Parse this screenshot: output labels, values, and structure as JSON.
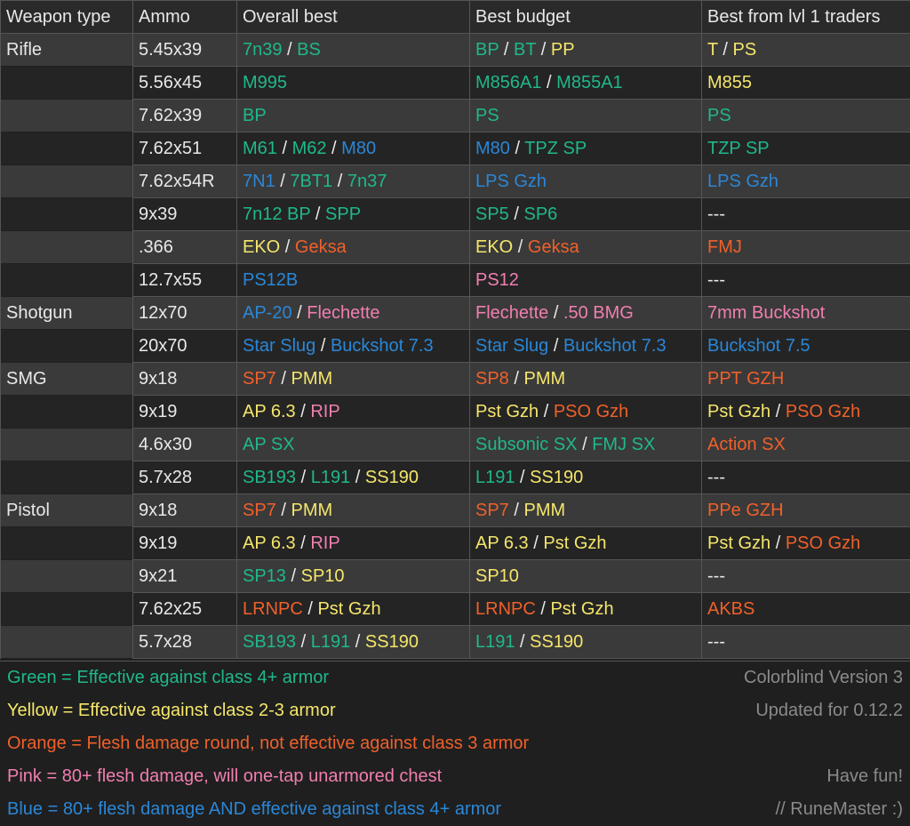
{
  "colors": {
    "green": "#1fb88b",
    "yellow": "#f5e66b",
    "orange": "#f0602a",
    "pink": "#f07fb0",
    "blue": "#2a87d8",
    "white": "#e8e8e8",
    "gray": "#8a8a8a"
  },
  "headers": [
    "Weapon type",
    "Ammo",
    "Overall best",
    "Best budget",
    "Best from lvl 1 traders"
  ],
  "groups": [
    {
      "weapon": "Rifle",
      "rows": [
        {
          "ammo": "5.45x39",
          "overall": [
            {
              "t": "7n39",
              "c": "green"
            },
            {
              "t": "BS",
              "c": "green"
            }
          ],
          "budget": [
            {
              "t": "BP",
              "c": "green"
            },
            {
              "t": "BT",
              "c": "green"
            },
            {
              "t": "PP",
              "c": "yellow"
            }
          ],
          "traders": [
            {
              "t": "T",
              "c": "yellow"
            },
            {
              "t": "PS",
              "c": "yellow"
            }
          ]
        },
        {
          "ammo": "5.56x45",
          "overall": [
            {
              "t": "M995",
              "c": "green"
            }
          ],
          "budget": [
            {
              "t": "M856A1",
              "c": "green"
            },
            {
              "t": "M855A1",
              "c": "green"
            }
          ],
          "traders": [
            {
              "t": "M855",
              "c": "yellow"
            }
          ]
        },
        {
          "ammo": "7.62x39",
          "overall": [
            {
              "t": "BP",
              "c": "green"
            }
          ],
          "budget": [
            {
              "t": "PS",
              "c": "green"
            }
          ],
          "traders": [
            {
              "t": "PS",
              "c": "green"
            }
          ]
        },
        {
          "ammo": "7.62x51",
          "overall": [
            {
              "t": "M61",
              "c": "green"
            },
            {
              "t": "M62",
              "c": "green"
            },
            {
              "t": "M80",
              "c": "blue"
            }
          ],
          "budget": [
            {
              "t": "M80",
              "c": "blue"
            },
            {
              "t": "TPZ SP",
              "c": "green"
            }
          ],
          "traders": [
            {
              "t": "TZP SP",
              "c": "green"
            }
          ]
        },
        {
          "ammo": "7.62x54R",
          "overall": [
            {
              "t": "7N1",
              "c": "blue"
            },
            {
              "t": "7BT1",
              "c": "green"
            },
            {
              "t": "7n37",
              "c": "green"
            }
          ],
          "budget": [
            {
              "t": "LPS Gzh",
              "c": "blue"
            }
          ],
          "traders": [
            {
              "t": "LPS Gzh",
              "c": "blue"
            }
          ]
        },
        {
          "ammo": "9x39",
          "overall": [
            {
              "t": "7n12 BP",
              "c": "green"
            },
            {
              "t": "SPP",
              "c": "green"
            }
          ],
          "budget": [
            {
              "t": "SP5",
              "c": "green"
            },
            {
              "t": "SP6",
              "c": "green"
            }
          ],
          "traders": [
            {
              "t": "---",
              "c": "white"
            }
          ]
        },
        {
          "ammo": ".366",
          "overall": [
            {
              "t": "EKO",
              "c": "yellow"
            },
            {
              "t": "Geksa",
              "c": "orange"
            }
          ],
          "budget": [
            {
              "t": "EKO",
              "c": "yellow"
            },
            {
              "t": "Geksa",
              "c": "orange"
            }
          ],
          "traders": [
            {
              "t": "FMJ",
              "c": "orange"
            }
          ]
        },
        {
          "ammo": "12.7x55",
          "overall": [
            {
              "t": "PS12B",
              "c": "blue"
            }
          ],
          "budget": [
            {
              "t": "PS12",
              "c": "pink"
            }
          ],
          "traders": [
            {
              "t": "---",
              "c": "white"
            }
          ]
        }
      ]
    },
    {
      "weapon": "Shotgun",
      "rows": [
        {
          "ammo": "12x70",
          "overall": [
            {
              "t": "AP-20",
              "c": "blue"
            },
            {
              "t": "Flechette",
              "c": "pink"
            }
          ],
          "budget": [
            {
              "t": "Flechette",
              "c": "pink"
            },
            {
              "t": ".50 BMG",
              "c": "pink"
            }
          ],
          "traders": [
            {
              "t": "7mm Buckshot",
              "c": "pink"
            }
          ]
        },
        {
          "ammo": "20x70",
          "overall": [
            {
              "t": "Star Slug",
              "c": "blue"
            },
            {
              "t": "Buckshot 7.3",
              "c": "blue"
            }
          ],
          "budget": [
            {
              "t": "Star Slug",
              "c": "blue"
            },
            {
              "t": "Buckshot 7.3",
              "c": "blue"
            }
          ],
          "traders": [
            {
              "t": "Buckshot 7.5",
              "c": "blue"
            }
          ]
        }
      ]
    },
    {
      "weapon": "SMG",
      "rows": [
        {
          "ammo": "9x18",
          "overall": [
            {
              "t": "SP7",
              "c": "orange"
            },
            {
              "t": "PMM",
              "c": "yellow"
            }
          ],
          "budget": [
            {
              "t": "SP8",
              "c": "orange"
            },
            {
              "t": "PMM",
              "c": "yellow"
            }
          ],
          "traders": [
            {
              "t": "PPT GZH",
              "c": "orange"
            }
          ]
        },
        {
          "ammo": "9x19",
          "overall": [
            {
              "t": "AP 6.3",
              "c": "yellow"
            },
            {
              "t": "RIP",
              "c": "pink"
            }
          ],
          "budget": [
            {
              "t": "Pst Gzh",
              "c": "yellow"
            },
            {
              "t": "PSO Gzh",
              "c": "orange"
            }
          ],
          "traders": [
            {
              "t": "Pst Gzh",
              "c": "yellow"
            },
            {
              "t": "PSO Gzh",
              "c": "orange"
            }
          ]
        },
        {
          "ammo": "4.6x30",
          "overall": [
            {
              "t": "AP SX",
              "c": "green"
            }
          ],
          "budget": [
            {
              "t": "Subsonic SX",
              "c": "green"
            },
            {
              "t": "FMJ SX",
              "c": "green"
            }
          ],
          "traders": [
            {
              "t": "Action SX",
              "c": "orange"
            }
          ]
        },
        {
          "ammo": "5.7x28",
          "overall": [
            {
              "t": "SB193",
              "c": "green"
            },
            {
              "t": "L191",
              "c": "green"
            },
            {
              "t": "SS190",
              "c": "yellow"
            }
          ],
          "budget": [
            {
              "t": "L191",
              "c": "green"
            },
            {
              "t": "SS190",
              "c": "yellow"
            }
          ],
          "traders": [
            {
              "t": "---",
              "c": "white"
            }
          ]
        }
      ]
    },
    {
      "weapon": "Pistol",
      "rows": [
        {
          "ammo": "9x18",
          "overall": [
            {
              "t": "SP7",
              "c": "orange"
            },
            {
              "t": "PMM",
              "c": "yellow"
            }
          ],
          "budget": [
            {
              "t": "SP7",
              "c": "orange"
            },
            {
              "t": "PMM",
              "c": "yellow"
            }
          ],
          "traders": [
            {
              "t": "PPe GZH",
              "c": "orange"
            }
          ]
        },
        {
          "ammo": "9x19",
          "overall": [
            {
              "t": "AP 6.3",
              "c": "yellow"
            },
            {
              "t": "RIP",
              "c": "pink"
            }
          ],
          "budget": [
            {
              "t": "AP 6.3",
              "c": "yellow"
            },
            {
              "t": "Pst Gzh",
              "c": "yellow"
            }
          ],
          "traders": [
            {
              "t": "Pst Gzh",
              "c": "yellow"
            },
            {
              "t": "PSO Gzh",
              "c": "orange"
            }
          ]
        },
        {
          "ammo": "9x21",
          "overall": [
            {
              "t": "SP13",
              "c": "green"
            },
            {
              "t": "SP10",
              "c": "yellow"
            }
          ],
          "budget": [
            {
              "t": "SP10",
              "c": "yellow"
            }
          ],
          "traders": [
            {
              "t": "---",
              "c": "white"
            }
          ]
        },
        {
          "ammo": "7.62x25",
          "overall": [
            {
              "t": "LRNPC",
              "c": "orange"
            },
            {
              "t": "Pst Gzh",
              "c": "yellow"
            }
          ],
          "budget": [
            {
              "t": "LRNPC",
              "c": "orange"
            },
            {
              "t": "Pst Gzh",
              "c": "yellow"
            }
          ],
          "traders": [
            {
              "t": "AKBS",
              "c": "orange"
            }
          ]
        },
        {
          "ammo": "5.7x28",
          "overall": [
            {
              "t": "SB193",
              "c": "green"
            },
            {
              "t": "L191",
              "c": "green"
            },
            {
              "t": "SS190",
              "c": "yellow"
            }
          ],
          "budget": [
            {
              "t": "L191",
              "c": "green"
            },
            {
              "t": "SS190",
              "c": "yellow"
            }
          ],
          "traders": [
            {
              "t": "---",
              "c": "white"
            }
          ]
        }
      ]
    }
  ],
  "legend": [
    {
      "text": "Green = Effective against class 4+ armor",
      "c": "green",
      "note": "Colorblind Version 3"
    },
    {
      "text": "Yellow = Effective against class 2-3 armor",
      "c": "yellow",
      "note": "Updated for 0.12.2"
    },
    {
      "text": "Orange = Flesh damage round, not effective against class 3 armor",
      "c": "orange",
      "note": ""
    },
    {
      "text": "Pink = 80+ flesh damage, will one-tap unarmored chest",
      "c": "pink",
      "note": "Have fun!"
    },
    {
      "text": "Blue = 80+ flesh damage AND effective against class 4+ armor",
      "c": "blue",
      "note": "// RuneMaster :)"
    }
  ]
}
